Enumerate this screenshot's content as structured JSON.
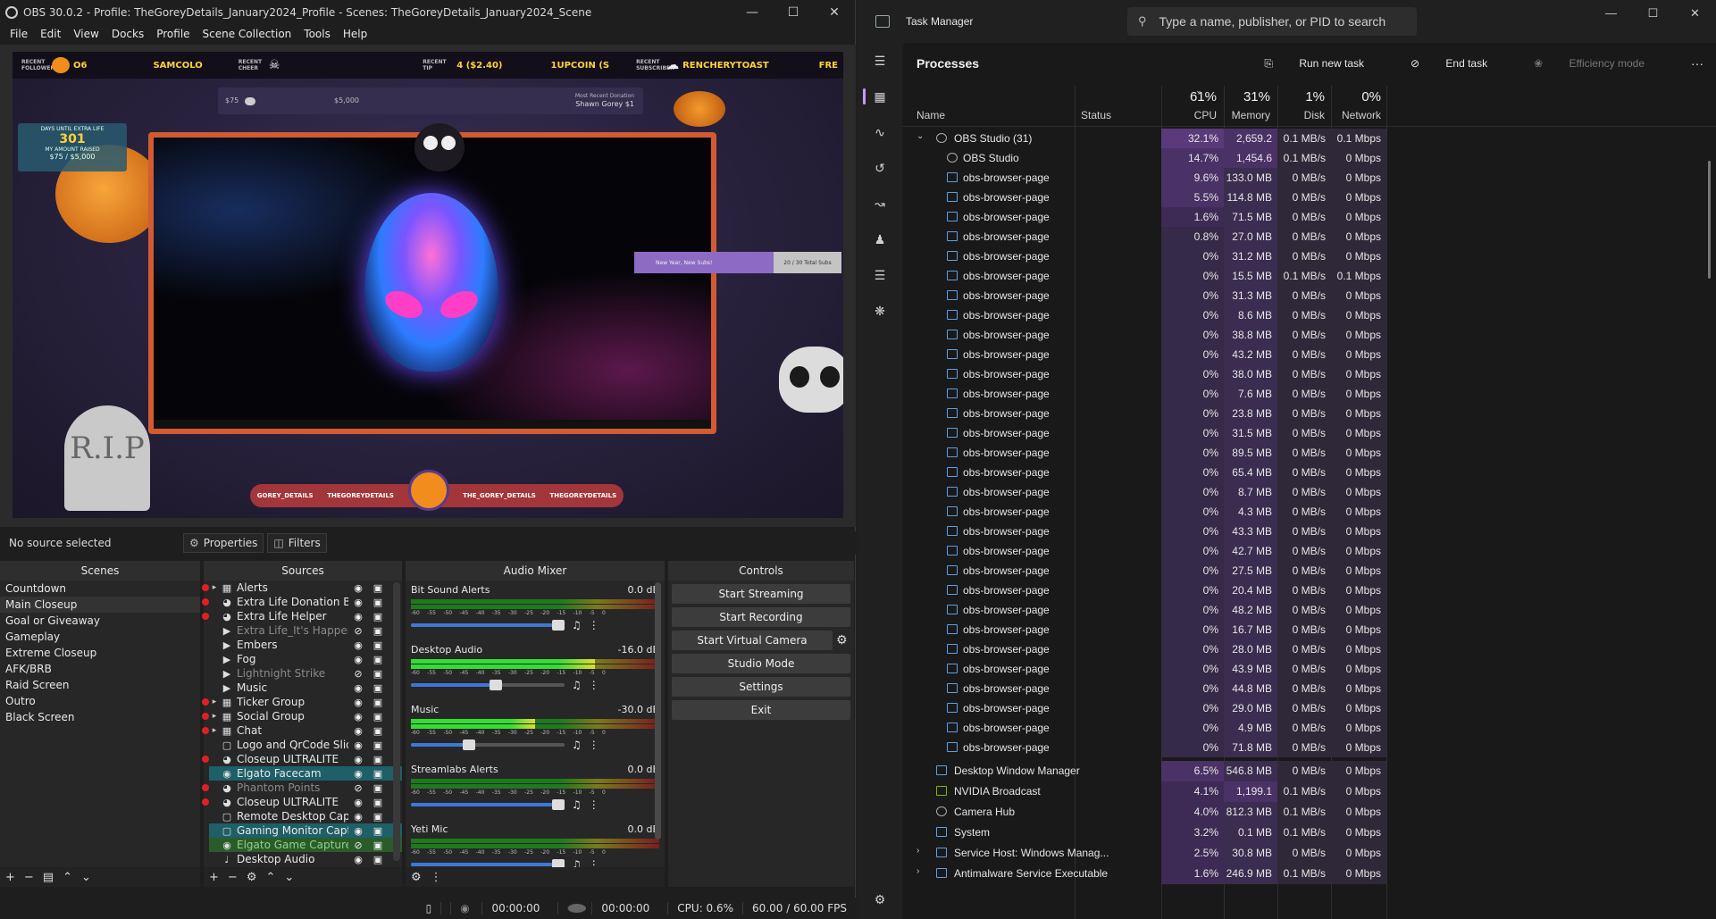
{
  "obs": {
    "title": "OBS 30.0.2 - Profile: TheGoreyDetails_January2024_Profile - Scenes: TheGoreyDetails_January2024_Scene",
    "menu": [
      "File",
      "Edit",
      "View",
      "Docks",
      "Profile",
      "Scene Collection",
      "Tools",
      "Help"
    ],
    "overlay": {
      "recent_follower_label": "RECENT FOLLOWER",
      "recent_follower": "O6",
      "recent_name": "SAMCOLO",
      "recent_cheer_label": "RECENT CHEER",
      "recent_tip_label": "RECENT TIP",
      "recent_tip": "4 ($2.40)",
      "recent_tip_name": "1UPCOIN (S",
      "recent_sub_label": "RECENT SUBSCRIBER",
      "recent_sub": "RENCHERYTOAST",
      "recent_sub_tail": "FRE",
      "goal_start": "$75",
      "goal_end": "$5,000",
      "goal_progress": 0.015,
      "donation_label": "Most Recent Donation",
      "donation_name": "Shawn Gorey $1",
      "extralife_label": "DAYS UNTIL EXTRA LIFE",
      "extralife_days": "301",
      "extralife_raised_label": "MY AMOUNT RAISED",
      "extralife_raised": "$75 / $5,000",
      "sub_goal_text": "New Year, New Subs!",
      "sub_goal_count": "20 / 30 Total Subs",
      "tomb_text": "R.I.P",
      "socials": [
        "GOREY_DETAILS",
        "THEGOREYDETAILS",
        "THE_GOREY_DETAILS",
        "THEGOREYDETAILS"
      ]
    },
    "status_row": {
      "no_source": "No source selected",
      "properties": "Properties",
      "filters": "Filters"
    },
    "docks": {
      "scenes_title": "Scenes",
      "sources_title": "Sources",
      "mixer_title": "Audio Mixer",
      "controls_title": "Controls"
    },
    "scenes": [
      "Countdown",
      "Main Closeup",
      "Goal or Giveaway",
      "Gameplay",
      "Extreme Closeup",
      "AFK/BRB",
      "Raid Screen",
      "Outro",
      "Black Screen"
    ],
    "sources": [
      {
        "name": "Alerts",
        "type": "folder",
        "expand": true,
        "dot": true,
        "state": "normal",
        "visible": true
      },
      {
        "name": "Extra Life Donation Bar",
        "type": "browser",
        "expand": false,
        "dot": true,
        "state": "normal",
        "visible": true
      },
      {
        "name": "Extra Life Helper",
        "type": "browser",
        "expand": false,
        "dot": true,
        "state": "normal",
        "visible": true
      },
      {
        "name": "Extra Life_It's Happenin",
        "type": "media",
        "expand": false,
        "dot": false,
        "state": "dim",
        "visible": false
      },
      {
        "name": "Embers",
        "type": "media",
        "expand": false,
        "dot": false,
        "state": "normal",
        "visible": true
      },
      {
        "name": "Fog",
        "type": "media",
        "expand": false,
        "dot": false,
        "state": "normal",
        "visible": true
      },
      {
        "name": "Lightnight Strike",
        "type": "media",
        "expand": false,
        "dot": false,
        "state": "dim",
        "visible": false
      },
      {
        "name": "Music",
        "type": "media",
        "expand": false,
        "dot": false,
        "state": "normal",
        "visible": true
      },
      {
        "name": "Ticker Group",
        "type": "folder",
        "expand": true,
        "dot": true,
        "state": "normal",
        "visible": true
      },
      {
        "name": "Social Group",
        "type": "folder",
        "expand": true,
        "dot": true,
        "state": "normal",
        "visible": true
      },
      {
        "name": "Chat",
        "type": "folder",
        "expand": true,
        "dot": true,
        "state": "normal",
        "visible": true
      },
      {
        "name": "Logo and QrCode Slide",
        "type": "image",
        "expand": false,
        "dot": false,
        "state": "normal",
        "visible": true
      },
      {
        "name": "Closeup ULTRALITE",
        "type": "browser",
        "expand": false,
        "dot": true,
        "state": "normal",
        "visible": true
      },
      {
        "name": "Elgato Facecam",
        "type": "camera",
        "expand": false,
        "dot": false,
        "state": "hl",
        "visible": true
      },
      {
        "name": "Phantom Points",
        "type": "browser",
        "expand": false,
        "dot": true,
        "state": "dim",
        "visible": false
      },
      {
        "name": "Closeup ULTRALITE",
        "type": "browser",
        "expand": false,
        "dot": true,
        "state": "normal",
        "visible": true
      },
      {
        "name": "Remote Desktop Captu",
        "type": "window",
        "expand": false,
        "dot": false,
        "state": "normal",
        "visible": true
      },
      {
        "name": "Gaming Monitor Captu",
        "type": "display",
        "expand": false,
        "dot": false,
        "state": "hl",
        "visible": true
      },
      {
        "name": "Elgato Game Capture H",
        "type": "camera",
        "expand": false,
        "dot": false,
        "state": "hl2",
        "visible": false
      },
      {
        "name": "Desktop Audio",
        "type": "audio",
        "expand": false,
        "dot": false,
        "state": "normal",
        "visible": true
      }
    ],
    "mixer": [
      {
        "name": "Bit Sound Alerts",
        "db": "0.0 dB",
        "level": 0.0,
        "volume": 0.96
      },
      {
        "name": "Desktop Audio",
        "db": "-16.0 dB",
        "level": 0.74,
        "volume": 0.55
      },
      {
        "name": "Music",
        "db": "-30.0 dB",
        "level": 0.5,
        "volume": 0.38
      },
      {
        "name": "Streamlabs Alerts",
        "db": "0.0 dB",
        "level": 0.0,
        "volume": 0.96
      },
      {
        "name": "Yeti Mic",
        "db": "0.0 dB",
        "level": 0.0,
        "volume": 0.96
      }
    ],
    "meter_scale": [
      "-60",
      "-55",
      "-50",
      "-45",
      "-40",
      "-35",
      "-30",
      "-25",
      "-20",
      "-15",
      "-10",
      "-5",
      "0"
    ],
    "controls": [
      "Start Streaming",
      "Start Recording",
      "Start Virtual Camera",
      "Studio Mode",
      "Settings",
      "Exit"
    ],
    "statusbar": {
      "stream_time": "00:00:00",
      "rec_time": "00:00:00",
      "cpu": "CPU: 0.6%",
      "fps": "60.00 / 60.00 FPS"
    }
  },
  "tm": {
    "title": "Task Manager",
    "search_placeholder": "Type a name, publisher, or PID to search",
    "page_title": "Processes",
    "actions": {
      "run": "Run new task",
      "end": "End task",
      "eff": "Efficiency mode",
      "more": "···"
    },
    "columns": {
      "name": "Name",
      "status": "Status",
      "cpu_pct": "61%",
      "cpu": "CPU",
      "mem_pct": "31%",
      "mem": "Memory",
      "disk_pct": "1%",
      "disk": "Disk",
      "net_pct": "0%",
      "net": "Network"
    },
    "processes": [
      {
        "name": "OBS Studio (31)",
        "cpu": "32.1%",
        "mem": "2,659.2 MB",
        "disk": "0.1 MB/s",
        "net": "0.1 Mbps",
        "level": 0,
        "expand": "open",
        "icon": "obs"
      },
      {
        "name": "OBS Studio",
        "cpu": "14.7%",
        "mem": "1,454.6 MB",
        "disk": "0.1 MB/s",
        "net": "0 Mbps",
        "level": 1,
        "expand": "",
        "icon": "obs"
      },
      {
        "name": "obs-browser-page",
        "cpu": "9.6%",
        "mem": "133.0 MB",
        "disk": "0 MB/s",
        "net": "0 Mbps",
        "level": 1,
        "expand": "",
        "icon": "app"
      },
      {
        "name": "obs-browser-page",
        "cpu": "5.5%",
        "mem": "114.8 MB",
        "disk": "0 MB/s",
        "net": "0 Mbps",
        "level": 1,
        "expand": "",
        "icon": "app"
      },
      {
        "name": "obs-browser-page",
        "cpu": "1.6%",
        "mem": "71.5 MB",
        "disk": "0 MB/s",
        "net": "0 Mbps",
        "level": 1,
        "expand": "",
        "icon": "app"
      },
      {
        "name": "obs-browser-page",
        "cpu": "0.8%",
        "mem": "27.0 MB",
        "disk": "0 MB/s",
        "net": "0 Mbps",
        "level": 1,
        "expand": "",
        "icon": "app"
      },
      {
        "name": "obs-browser-page",
        "cpu": "0%",
        "mem": "31.2 MB",
        "disk": "0 MB/s",
        "net": "0 Mbps",
        "level": 1,
        "expand": "",
        "icon": "app"
      },
      {
        "name": "obs-browser-page",
        "cpu": "0%",
        "mem": "15.5 MB",
        "disk": "0.1 MB/s",
        "net": "0.1 Mbps",
        "level": 1,
        "expand": "",
        "icon": "app"
      },
      {
        "name": "obs-browser-page",
        "cpu": "0%",
        "mem": "31.3 MB",
        "disk": "0 MB/s",
        "net": "0 Mbps",
        "level": 1,
        "expand": "",
        "icon": "app"
      },
      {
        "name": "obs-browser-page",
        "cpu": "0%",
        "mem": "8.6 MB",
        "disk": "0 MB/s",
        "net": "0 Mbps",
        "level": 1,
        "expand": "",
        "icon": "app"
      },
      {
        "name": "obs-browser-page",
        "cpu": "0%",
        "mem": "38.8 MB",
        "disk": "0 MB/s",
        "net": "0 Mbps",
        "level": 1,
        "expand": "",
        "icon": "app"
      },
      {
        "name": "obs-browser-page",
        "cpu": "0%",
        "mem": "43.2 MB",
        "disk": "0 MB/s",
        "net": "0 Mbps",
        "level": 1,
        "expand": "",
        "icon": "app"
      },
      {
        "name": "obs-browser-page",
        "cpu": "0%",
        "mem": "38.0 MB",
        "disk": "0 MB/s",
        "net": "0 Mbps",
        "level": 1,
        "expand": "",
        "icon": "app"
      },
      {
        "name": "obs-browser-page",
        "cpu": "0%",
        "mem": "7.6 MB",
        "disk": "0 MB/s",
        "net": "0 Mbps",
        "level": 1,
        "expand": "",
        "icon": "app"
      },
      {
        "name": "obs-browser-page",
        "cpu": "0%",
        "mem": "23.8 MB",
        "disk": "0 MB/s",
        "net": "0 Mbps",
        "level": 1,
        "expand": "",
        "icon": "app"
      },
      {
        "name": "obs-browser-page",
        "cpu": "0%",
        "mem": "31.5 MB",
        "disk": "0 MB/s",
        "net": "0 Mbps",
        "level": 1,
        "expand": "",
        "icon": "app"
      },
      {
        "name": "obs-browser-page",
        "cpu": "0%",
        "mem": "89.5 MB",
        "disk": "0 MB/s",
        "net": "0 Mbps",
        "level": 1,
        "expand": "",
        "icon": "app"
      },
      {
        "name": "obs-browser-page",
        "cpu": "0%",
        "mem": "65.4 MB",
        "disk": "0 MB/s",
        "net": "0 Mbps",
        "level": 1,
        "expand": "",
        "icon": "app"
      },
      {
        "name": "obs-browser-page",
        "cpu": "0%",
        "mem": "8.7 MB",
        "disk": "0 MB/s",
        "net": "0 Mbps",
        "level": 1,
        "expand": "",
        "icon": "app"
      },
      {
        "name": "obs-browser-page",
        "cpu": "0%",
        "mem": "4.3 MB",
        "disk": "0 MB/s",
        "net": "0 Mbps",
        "level": 1,
        "expand": "",
        "icon": "app"
      },
      {
        "name": "obs-browser-page",
        "cpu": "0%",
        "mem": "43.3 MB",
        "disk": "0 MB/s",
        "net": "0 Mbps",
        "level": 1,
        "expand": "",
        "icon": "app"
      },
      {
        "name": "obs-browser-page",
        "cpu": "0%",
        "mem": "42.7 MB",
        "disk": "0 MB/s",
        "net": "0 Mbps",
        "level": 1,
        "expand": "",
        "icon": "app"
      },
      {
        "name": "obs-browser-page",
        "cpu": "0%",
        "mem": "27.5 MB",
        "disk": "0 MB/s",
        "net": "0 Mbps",
        "level": 1,
        "expand": "",
        "icon": "app"
      },
      {
        "name": "obs-browser-page",
        "cpu": "0%",
        "mem": "20.4 MB",
        "disk": "0 MB/s",
        "net": "0 Mbps",
        "level": 1,
        "expand": "",
        "icon": "app"
      },
      {
        "name": "obs-browser-page",
        "cpu": "0%",
        "mem": "48.2 MB",
        "disk": "0 MB/s",
        "net": "0 Mbps",
        "level": 1,
        "expand": "",
        "icon": "app"
      },
      {
        "name": "obs-browser-page",
        "cpu": "0%",
        "mem": "16.7 MB",
        "disk": "0 MB/s",
        "net": "0 Mbps",
        "level": 1,
        "expand": "",
        "icon": "app"
      },
      {
        "name": "obs-browser-page",
        "cpu": "0%",
        "mem": "28.0 MB",
        "disk": "0 MB/s",
        "net": "0 Mbps",
        "level": 1,
        "expand": "",
        "icon": "app"
      },
      {
        "name": "obs-browser-page",
        "cpu": "0%",
        "mem": "43.9 MB",
        "disk": "0 MB/s",
        "net": "0 Mbps",
        "level": 1,
        "expand": "",
        "icon": "app"
      },
      {
        "name": "obs-browser-page",
        "cpu": "0%",
        "mem": "44.8 MB",
        "disk": "0 MB/s",
        "net": "0 Mbps",
        "level": 1,
        "expand": "",
        "icon": "app"
      },
      {
        "name": "obs-browser-page",
        "cpu": "0%",
        "mem": "29.0 MB",
        "disk": "0 MB/s",
        "net": "0 Mbps",
        "level": 1,
        "expand": "",
        "icon": "app"
      },
      {
        "name": "obs-browser-page",
        "cpu": "0%",
        "mem": "4.9 MB",
        "disk": "0 MB/s",
        "net": "0 Mbps",
        "level": 1,
        "expand": "",
        "icon": "app"
      },
      {
        "name": "obs-browser-page",
        "cpu": "0%",
        "mem": "71.8 MB",
        "disk": "0 MB/s",
        "net": "0 Mbps",
        "level": 1,
        "expand": "",
        "icon": "app"
      },
      {
        "name": "Desktop Window Manager",
        "cpu": "6.5%",
        "mem": "546.8 MB",
        "disk": "0 MB/s",
        "net": "0 Mbps",
        "level": 0,
        "expand": "",
        "icon": "app"
      },
      {
        "name": "NVIDIA Broadcast",
        "cpu": "4.1%",
        "mem": "1,199.1 MB",
        "disk": "0.1 MB/s",
        "net": "0 Mbps",
        "level": 0,
        "expand": "",
        "icon": "nv"
      },
      {
        "name": "Camera Hub",
        "cpu": "4.0%",
        "mem": "812.3 MB",
        "disk": "0.1 MB/s",
        "net": "0 Mbps",
        "level": 0,
        "expand": "",
        "icon": "obs"
      },
      {
        "name": "System",
        "cpu": "3.2%",
        "mem": "0.1 MB",
        "disk": "0.1 MB/s",
        "net": "0 Mbps",
        "level": 0,
        "expand": "",
        "icon": "app"
      },
      {
        "name": "Service Host: Windows Manag...",
        "cpu": "2.5%",
        "mem": "30.8 MB",
        "disk": "0 MB/s",
        "net": "0 Mbps",
        "level": 0,
        "expand": "closed",
        "icon": "app"
      },
      {
        "name": "Antimalware Service Executable",
        "cpu": "1.6%",
        "mem": "246.9 MB",
        "disk": "0.1 MB/s",
        "net": "0 Mbps",
        "level": 0,
        "expand": "closed",
        "icon": "app"
      }
    ]
  }
}
